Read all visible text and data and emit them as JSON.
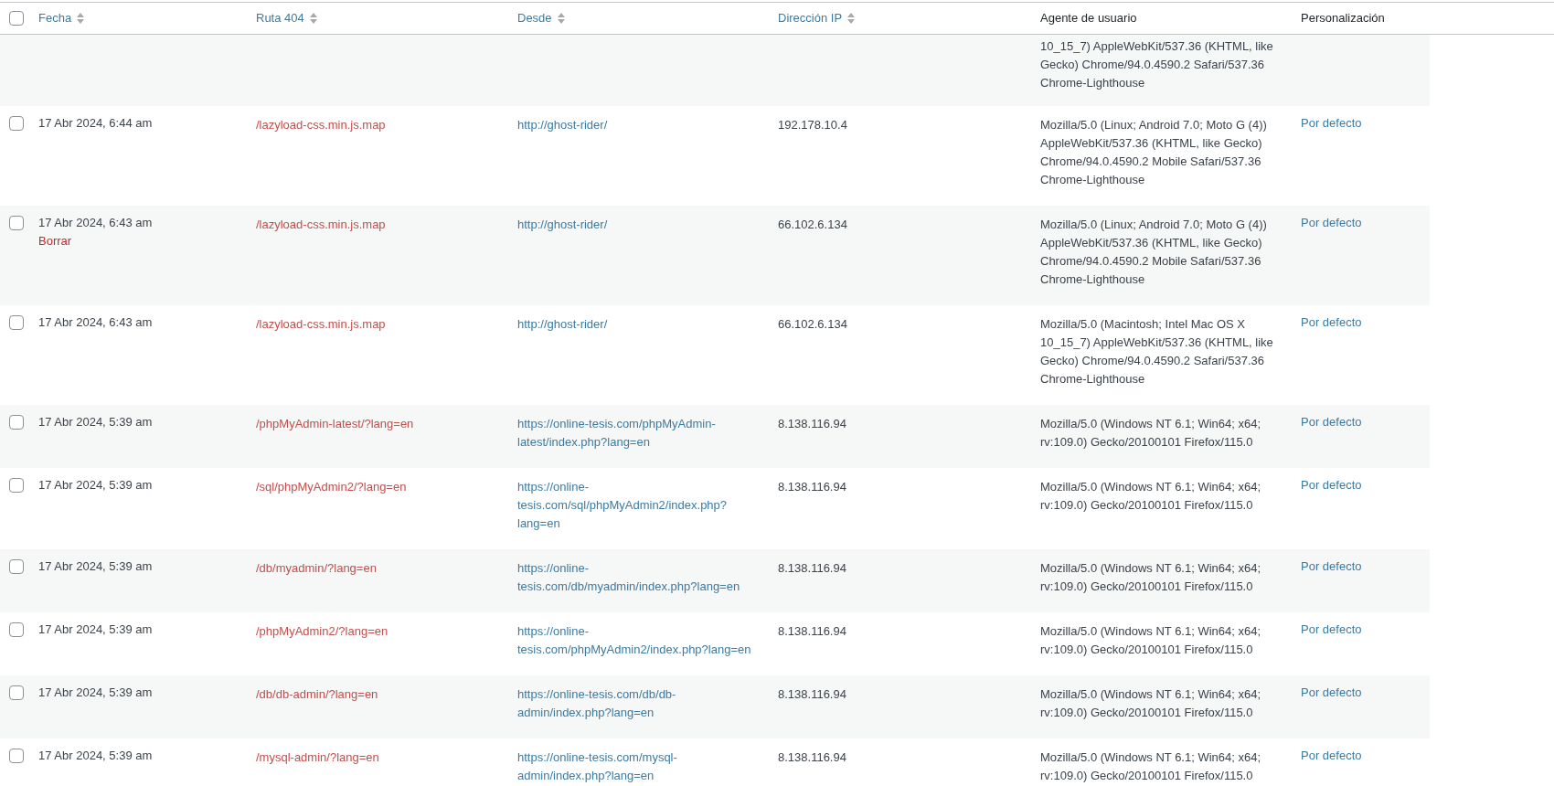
{
  "table": {
    "select_all_checked": false,
    "columns": [
      {
        "label": "Fecha",
        "sortable": true
      },
      {
        "label": "Ruta 404",
        "sortable": true
      },
      {
        "label": "Desde",
        "sortable": true
      },
      {
        "label": "Dirección IP",
        "sortable": true
      },
      {
        "label": "Agente de usuario",
        "sortable": false
      },
      {
        "label": "Personalización",
        "sortable": false
      }
    ],
    "rows": [
      {
        "user_agent": "10_15_7) AppleWebKit/537.36 (KHTML, like Gecko) Chrome/94.0.4590.2 Safari/537.36 Chrome-Lighthouse"
      },
      {
        "checked": false,
        "date": "17 Abr 2024, 6:44 am",
        "path": "/lazyload-css.min.js.map",
        "from": "http://ghost-rider/",
        "ip": "192.178.10.4",
        "user_agent": "Mozilla/5.0 (Linux; Android 7.0; Moto G (4)) AppleWebKit/537.36 (KHTML, like Gecko) Chrome/94.0.4590.2 Mobile Safari/537.36 Chrome-Lighthouse",
        "custom": "Por defecto"
      },
      {
        "checked": false,
        "date": "17 Abr 2024, 6:43 am",
        "actions": [
          "Borrar"
        ],
        "path": "/lazyload-css.min.js.map",
        "from": "http://ghost-rider/",
        "ip": "66.102.6.134",
        "user_agent": "Mozilla/5.0 (Linux; Android 7.0; Moto G (4)) AppleWebKit/537.36 (KHTML, like Gecko) Chrome/94.0.4590.2 Mobile Safari/537.36 Chrome-Lighthouse",
        "custom": "Por defecto"
      },
      {
        "checked": false,
        "date": "17 Abr 2024, 6:43 am",
        "path": "/lazyload-css.min.js.map",
        "from": "http://ghost-rider/",
        "ip": "66.102.6.134",
        "user_agent": "Mozilla/5.0 (Macintosh; Intel Mac OS X 10_15_7) AppleWebKit/537.36 (KHTML, like Gecko) Chrome/94.0.4590.2 Safari/537.36 Chrome-Lighthouse",
        "custom": "Por defecto"
      },
      {
        "checked": false,
        "date": "17 Abr 2024, 5:39 am",
        "path": "/phpMyAdmin-latest/?lang=en",
        "from": "https://online-tesis.com/phpMyAdmin-latest/index.php?lang=en",
        "ip": "8.138.116.94",
        "user_agent": "Mozilla/5.0 (Windows NT 6.1; Win64; x64; rv:109.0) Gecko/20100101 Firefox/115.0",
        "custom": "Por defecto"
      },
      {
        "checked": false,
        "date": "17 Abr 2024, 5:39 am",
        "path": "/sql/phpMyAdmin2/?lang=en",
        "from": "https://online-tesis.com/sql/phpMyAdmin2/index.php?lang=en",
        "ip": "8.138.116.94",
        "user_agent": "Mozilla/5.0 (Windows NT 6.1; Win64; x64; rv:109.0) Gecko/20100101 Firefox/115.0",
        "custom": "Por defecto"
      },
      {
        "checked": false,
        "date": "17 Abr 2024, 5:39 am",
        "path": "/db/myadmin/?lang=en",
        "from": "https://online-tesis.com/db/myadmin/index.php?lang=en",
        "ip": "8.138.116.94",
        "user_agent": "Mozilla/5.0 (Windows NT 6.1; Win64; x64; rv:109.0) Gecko/20100101 Firefox/115.0",
        "custom": "Por defecto"
      },
      {
        "checked": false,
        "date": "17 Abr 2024, 5:39 am",
        "path": "/phpMyAdmin2/?lang=en",
        "from": "https://online-tesis.com/phpMyAdmin2/index.php?lang=en",
        "ip": "8.138.116.94",
        "user_agent": "Mozilla/5.0 (Windows NT 6.1; Win64; x64; rv:109.0) Gecko/20100101 Firefox/115.0",
        "custom": "Por defecto"
      },
      {
        "checked": false,
        "date": "17 Abr 2024, 5:39 am",
        "path": "/db/db-admin/?lang=en",
        "from": "https://online-tesis.com/db/db-admin/index.php?lang=en",
        "ip": "8.138.116.94",
        "user_agent": "Mozilla/5.0 (Windows NT 6.1; Win64; x64; rv:109.0) Gecko/20100101 Firefox/115.0",
        "custom": "Por defecto"
      },
      {
        "checked": false,
        "date": "17 Abr 2024, 5:39 am",
        "path": "/mysql-admin/?lang=en",
        "from": "https://online-tesis.com/mysql-admin/index.php?lang=en",
        "ip": "8.138.116.94",
        "user_agent": "Mozilla/5.0 (Windows NT 6.1; Win64; x64; rv:109.0) Gecko/20100101 Firefox/115.0",
        "custom": "Por defecto"
      }
    ]
  }
}
